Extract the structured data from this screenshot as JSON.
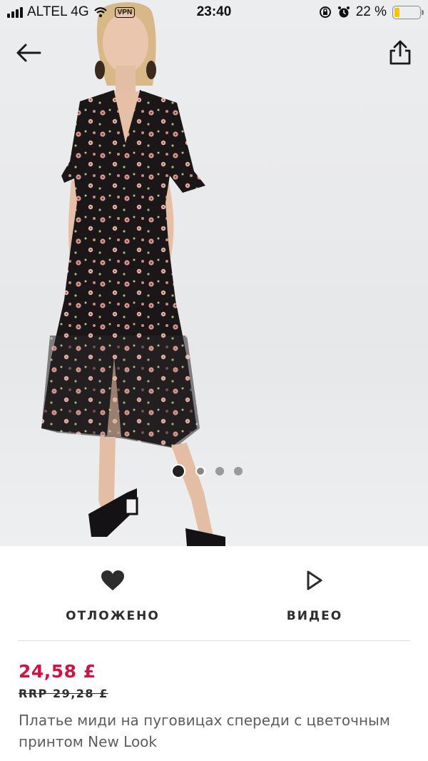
{
  "status_bar": {
    "carrier": "ALTEL 4G",
    "vpn": "VPN",
    "time": "23:40",
    "battery_percent": "22 %",
    "battery_level": 0.22
  },
  "gallery": {
    "image_description_icon": "dress-photo",
    "pages": 4,
    "active_page": 1
  },
  "actions": {
    "save_label": "ОТЛОЖЕНО",
    "video_label": "ВИДЕО"
  },
  "product": {
    "price": "24,58 £",
    "rrp": "RRP 29,28 £",
    "title": "Платье миди на пуговицах спереди с цветочным принтом New Look"
  },
  "colors": {
    "price": "#d01345",
    "text": "#2d2d2d",
    "battery": "#f5c400"
  }
}
